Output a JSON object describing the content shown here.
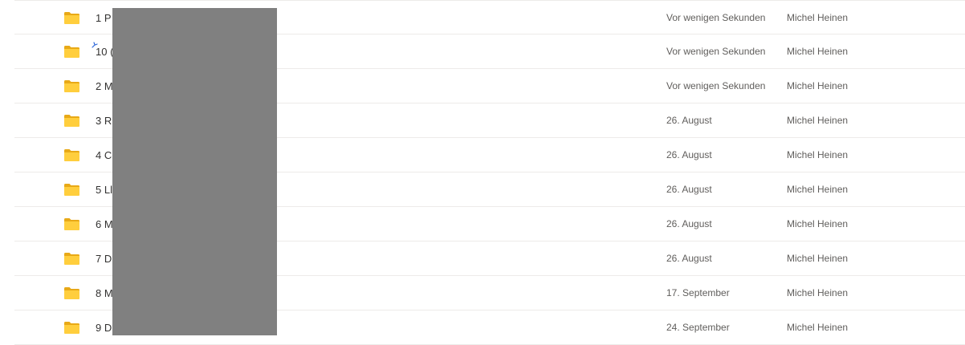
{
  "rows": [
    {
      "name": "1 P",
      "modified": "Vor wenigen Sekunden",
      "modified_by": "Michel Heinen",
      "new": false
    },
    {
      "name": "10 (",
      "modified": "Vor wenigen Sekunden",
      "modified_by": "Michel Heinen",
      "new": true
    },
    {
      "name": "2 M",
      "modified": "Vor wenigen Sekunden",
      "modified_by": "Michel Heinen",
      "new": false
    },
    {
      "name": "3 R",
      "modified": "26. August",
      "modified_by": "Michel Heinen",
      "new": false
    },
    {
      "name": "4 C",
      "modified": "26. August",
      "modified_by": "Michel Heinen",
      "new": false
    },
    {
      "name": "5 Ll",
      "modified": "26. August",
      "modified_by": "Michel Heinen",
      "new": false
    },
    {
      "name": "6 M",
      "modified": "26. August",
      "modified_by": "Michel Heinen",
      "new": false
    },
    {
      "name": "7 D",
      "modified": "26. August",
      "modified_by": "Michel Heinen",
      "new": false
    },
    {
      "name": "8 M",
      "modified": "17. September",
      "modified_by": "Michel Heinen",
      "new": false
    },
    {
      "name": "9 D",
      "modified": "24. September",
      "modified_by": "Michel Heinen",
      "new": false
    }
  ],
  "icons": {
    "folder": "folder-icon",
    "new": "new-item-sparkle-icon"
  },
  "colors": {
    "folder_fill": "#ffce3d",
    "folder_back": "#e8a917",
    "new_indicator": "#2b65d9",
    "redaction": "#808080"
  }
}
